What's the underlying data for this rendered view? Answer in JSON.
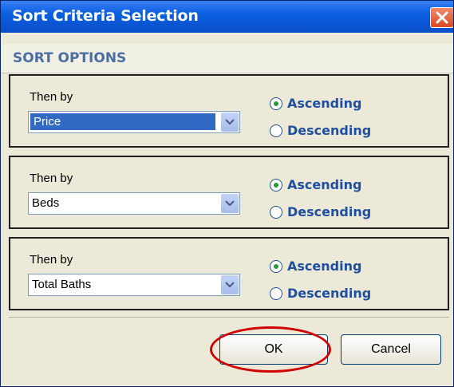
{
  "window": {
    "title": "Sort Criteria Selection"
  },
  "header": {
    "title": "SORT OPTIONS"
  },
  "criteria": [
    {
      "label": "Then by",
      "value": "Price",
      "selected": true,
      "ascending": "Ascending",
      "descending": "Descending",
      "order": "ascending"
    },
    {
      "label": "Then by",
      "value": "Beds",
      "selected": false,
      "ascending": "Ascending",
      "descending": "Descending",
      "order": "ascending"
    },
    {
      "label": "Then by",
      "value": "Total Baths",
      "selected": false,
      "ascending": "Ascending",
      "descending": "Descending",
      "order": "ascending"
    }
  ],
  "buttons": {
    "ok": "OK",
    "cancel": "Cancel"
  },
  "colors": {
    "titlebar": "#0a5fe0",
    "accent": "#316ac5",
    "annotation": "#d00000"
  },
  "icons": {
    "close": "close-icon",
    "dropdown": "chevron-down-icon",
    "radio": "radio-icon"
  }
}
